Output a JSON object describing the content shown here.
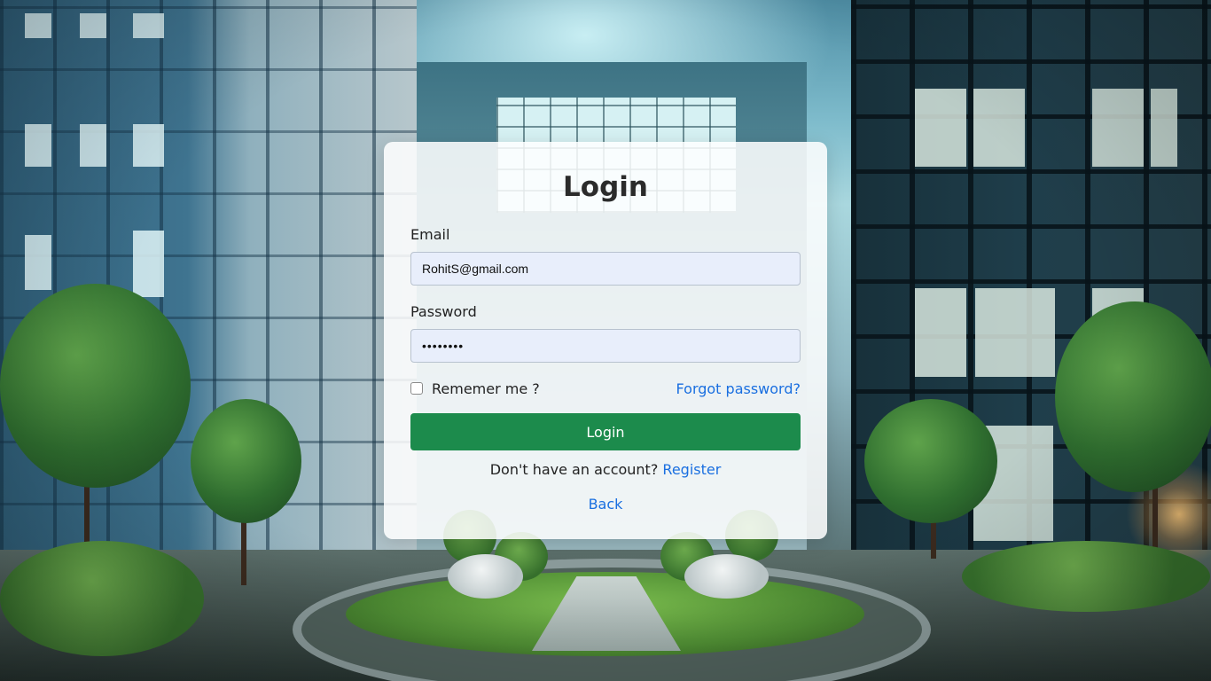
{
  "login": {
    "title": "Login",
    "email_label": "Email",
    "email_value": "RohitS@gmail.com",
    "password_label": "Password",
    "password_value": "password",
    "remember_label": "Rememer me ?",
    "forgot_link": "Forgot password?",
    "submit_label": "Login",
    "no_account_text": "Don't have an account?",
    "register_link": "Register",
    "back_link": "Back"
  },
  "colors": {
    "submit_button": "#1c8b4c",
    "link": "#1a6fe0",
    "input_background": "#e8eefb"
  }
}
